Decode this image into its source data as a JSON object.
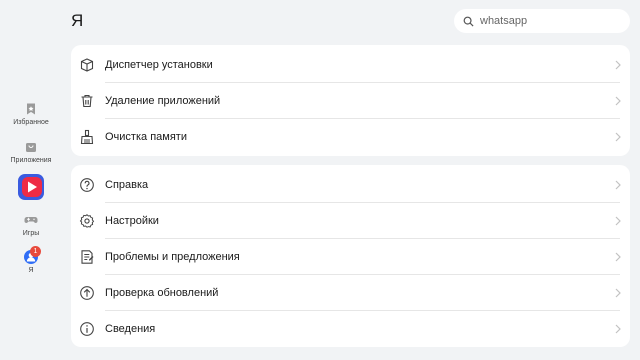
{
  "header": {
    "title": "Я"
  },
  "search": {
    "query": "whatsapp"
  },
  "rail": {
    "favorites": "Избранное",
    "apps": "Приложения",
    "games": "Игры",
    "me": "Я",
    "me_badge": "1"
  },
  "menu": {
    "group1": [
      {
        "label": "Диспетчер установки",
        "icon": "package-icon"
      },
      {
        "label": "Удаление приложений",
        "icon": "trash-icon"
      },
      {
        "label": "Очистка памяти",
        "icon": "broom-icon"
      }
    ],
    "group2": [
      {
        "label": "Справка",
        "icon": "help-icon"
      },
      {
        "label": "Настройки",
        "icon": "gear-icon"
      },
      {
        "label": "Проблемы и предложения",
        "icon": "feedback-icon"
      },
      {
        "label": "Проверка обновлений",
        "icon": "update-icon"
      },
      {
        "label": "Сведения",
        "icon": "info-icon"
      }
    ]
  },
  "colors": {
    "accent": "#2f6df6",
    "badge": "#e84a3c",
    "background": "#f1f3f5"
  }
}
